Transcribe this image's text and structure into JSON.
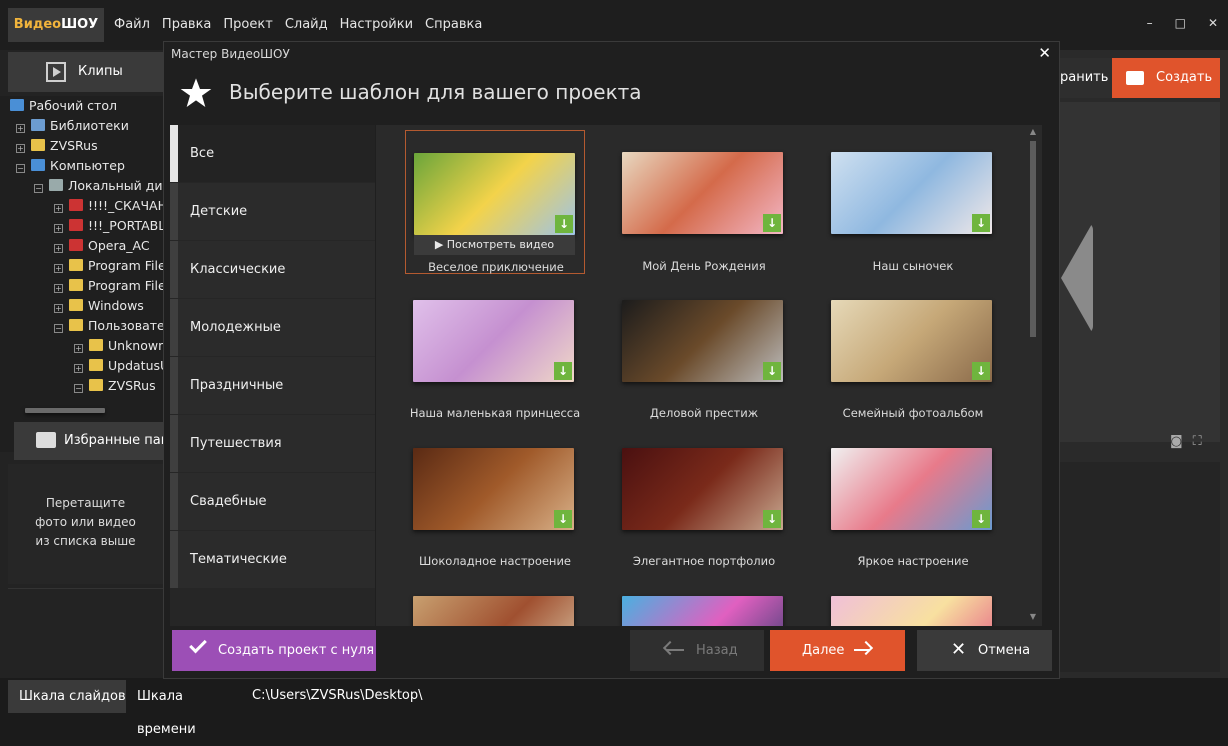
{
  "app": {
    "logo_part1": "Видео",
    "logo_part2": "ШОУ",
    "menu": [
      "Файл",
      "Правка",
      "Проект",
      "Слайд",
      "Настройки",
      "Справка"
    ],
    "window_controls": {
      "minimize": "–",
      "maximize": "□",
      "close": "✕"
    }
  },
  "left_panel": {
    "clips_tab": "Клипы",
    "tree": [
      {
        "label": "Рабочий стол",
        "icon": "desktop-icon",
        "expander": ""
      },
      {
        "label": "Библиотеки",
        "icon": "library-icon",
        "expander": "+"
      },
      {
        "label": "ZVSRus",
        "icon": "folder-icon",
        "expander": "+"
      },
      {
        "label": "Компьютер",
        "icon": "computer-icon",
        "expander": "−"
      },
      {
        "label": "Локальный диск",
        "icon": "drive-icon",
        "expander": "−"
      },
      {
        "label": "!!!!_СКАЧАНО",
        "icon": "red-folder-icon",
        "expander": "+"
      },
      {
        "label": "!!!_PORTABLE",
        "icon": "red-folder-icon",
        "expander": "+"
      },
      {
        "label": "Opera_AC",
        "icon": "red-folder-icon",
        "expander": "+"
      },
      {
        "label": "Program Files",
        "icon": "folder-icon",
        "expander": "+"
      },
      {
        "label": "Program Files",
        "icon": "folder-icon",
        "expander": "+"
      },
      {
        "label": "Windows",
        "icon": "folder-icon",
        "expander": "+"
      },
      {
        "label": "Пользователи",
        "icon": "folder-icon",
        "expander": "−"
      },
      {
        "label": "Unknown",
        "icon": "folder-icon",
        "expander": "+"
      },
      {
        "label": "UpdatusUser",
        "icon": "folder-icon",
        "expander": "+"
      },
      {
        "label": "ZVSRus",
        "icon": "folder-icon",
        "expander": "−"
      }
    ],
    "favorites_tab": "Избранные папки",
    "drop_hint": [
      "Перетащите",
      "фото или видео",
      "из списка выше"
    ]
  },
  "right_panel": {
    "save_label": "ранить",
    "create_label": "Создать"
  },
  "bottom": {
    "tab_slides": "Шкала слайдов",
    "tab_timeline": "Шкала времени",
    "path": "C:\\Users\\ZVSRus\\Desktop\\"
  },
  "dialog": {
    "title": "Мастер ВидеоШОУ",
    "close": "✕",
    "header": "Выберите шаблон для вашего проекта",
    "categories": [
      "Все",
      "Детские",
      "Классические",
      "Молодежные",
      "Праздничные",
      "Путешествия",
      "Свадебные",
      "Тематические"
    ],
    "active_category": "Все",
    "watch_video": "▶ Посмотреть видео",
    "templates": [
      {
        "label": "Веселое приключение",
        "colors": [
          "#6aa53a",
          "#f3d34a",
          "#9ec3e6"
        ]
      },
      {
        "label": "Мой День Рождения",
        "colors": [
          "#e8d8c0",
          "#d46a4a",
          "#f3b6c6"
        ]
      },
      {
        "label": "Наш сыночек",
        "colors": [
          "#cfe0f0",
          "#8fb8e0",
          "#f0e8e8"
        ]
      },
      {
        "label": "Наша маленькая принцесса",
        "colors": [
          "#e0c0ea",
          "#c590d0",
          "#f0d8c8"
        ]
      },
      {
        "label": "Деловой престиж",
        "colors": [
          "#1c1c1c",
          "#6a4a2a",
          "#bdbdbd"
        ]
      },
      {
        "label": "Семейный фотоальбом",
        "colors": [
          "#e6d9b8",
          "#c6a878",
          "#8a6a4a"
        ]
      },
      {
        "label": "Шоколадное настроение",
        "colors": [
          "#5a2a14",
          "#a05a2a",
          "#d8b088"
        ]
      },
      {
        "label": "Элегантное портфолио",
        "colors": [
          "#4a1010",
          "#7a2a1a",
          "#c8a890"
        ]
      },
      {
        "label": "Яркое настроение",
        "colors": [
          "#f0f0f0",
          "#e87a8a",
          "#6a9ad0"
        ]
      },
      {
        "label": "",
        "colors": [
          "#c8a070",
          "#a05030",
          "#e0d0b0"
        ]
      },
      {
        "label": "",
        "colors": [
          "#4ab0e0",
          "#e060c0",
          "#2a3a6a"
        ]
      },
      {
        "label": "",
        "colors": [
          "#f0c0d8",
          "#f8e0a0",
          "#e04a80"
        ]
      }
    ],
    "download_icon": "↓",
    "buttons": {
      "new_project": "Создать проект с нуля",
      "back": "Назад",
      "next": "Далее",
      "cancel": "Отмена"
    }
  }
}
